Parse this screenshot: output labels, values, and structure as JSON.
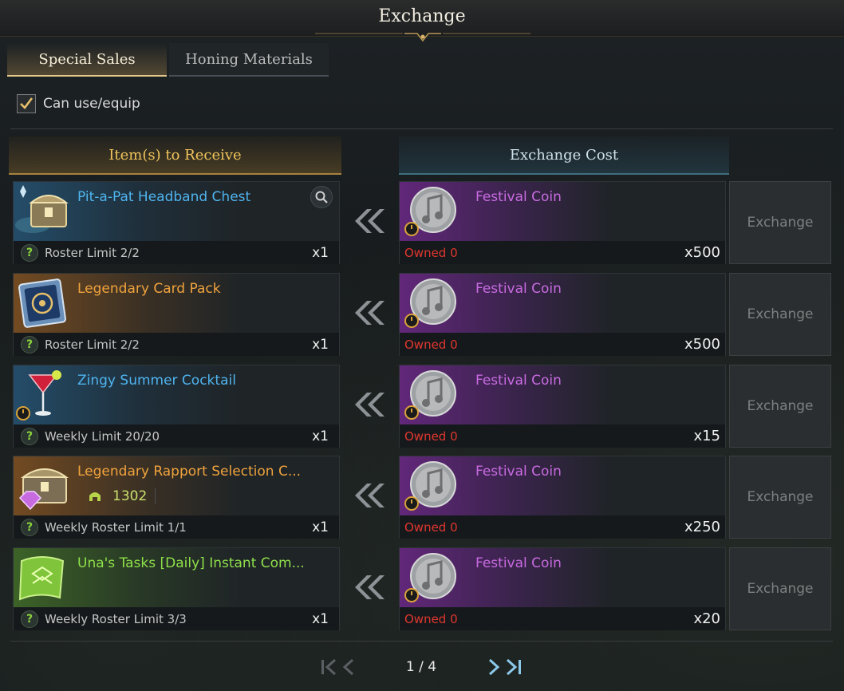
{
  "window": {
    "title": "Exchange"
  },
  "tabs": [
    {
      "label": "Special Sales",
      "active": true
    },
    {
      "label": "Honing Materials",
      "active": false
    }
  ],
  "filter": {
    "label": "Can use/equip",
    "checked": true
  },
  "headers": {
    "receive": "Item(s) to Receive",
    "cost": "Exchange Cost"
  },
  "rows": [
    {
      "item_name": "Pit-a-Pat Headband Chest",
      "name_color": "#4fb4ef",
      "limit": "Roster Limit 2/2",
      "qty": "x1",
      "icon": "chest-icon",
      "cost_name": "Festival Coin",
      "owned": "Owned 0",
      "cost_qty": "x500",
      "button": "Exchange"
    },
    {
      "item_name": "Legendary Card Pack",
      "name_color": "#f0a33d",
      "limit": "Roster Limit 2/2",
      "qty": "x1",
      "icon": "card-pack-icon",
      "cost_name": "Festival Coin",
      "owned": "Owned 0",
      "cost_qty": "x500",
      "button": "Exchange"
    },
    {
      "item_name": "Zingy Summer Cocktail",
      "name_color": "#4fb4ef",
      "limit": "Weekly Limit 20/20",
      "qty": "x1",
      "icon": "cocktail-icon",
      "cost_name": "Festival Coin",
      "owned": "Owned 0",
      "cost_qty": "x15",
      "button": "Exchange"
    },
    {
      "item_name": "Legendary Rapport Selection C...",
      "name_color": "#f0a33d",
      "limit": "Weekly Roster Limit 1/1",
      "qty": "x1",
      "icon": "rapport-chest-icon",
      "power": "1302",
      "cost_name": "Festival Coin",
      "owned": "Owned 0",
      "cost_qty": "x250",
      "button": "Exchange"
    },
    {
      "item_name": "Una's Tasks [Daily] Instant Com...",
      "name_color": "#8fe04a",
      "limit": "Weekly Roster Limit 3/3",
      "qty": "x1",
      "icon": "scroll-icon",
      "cost_name": "Festival Coin",
      "owned": "Owned 0",
      "cost_qty": "x20",
      "button": "Exchange"
    }
  ],
  "pager": {
    "text": "1 / 4"
  },
  "colors": {
    "legendary": "#f0a33d",
    "rare": "#4fb4ef",
    "uncommon": "#8fe04a",
    "coin_purple": "#c86be0",
    "owned_red": "#e0362f",
    "gold": "#f0c45b"
  }
}
